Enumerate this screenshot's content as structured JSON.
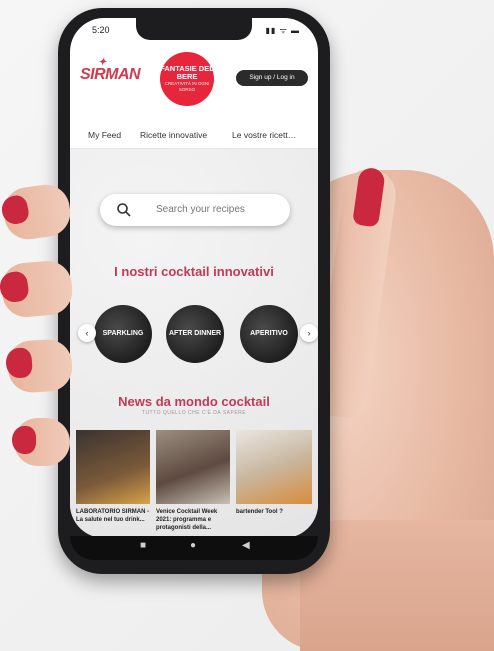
{
  "status": {
    "time": "5:20",
    "icons": "▮▮ ᯤ ▬"
  },
  "header": {
    "brand": "SIRMAN",
    "badge_line1": "FANTASIE DEL BERE",
    "badge_line2": "CREATIVITÀ IN OGNI SORSO",
    "signup": "Sign up / Log in"
  },
  "tabs": [
    {
      "label": "My Feed"
    },
    {
      "label": "Ricette innovative"
    },
    {
      "label": "Le vostre ricett…"
    }
  ],
  "search": {
    "placeholder": "Search your recipes"
  },
  "section_cocktails": {
    "title": "I nostri cocktail innovativi",
    "categories": [
      {
        "label": "SPARKLING"
      },
      {
        "label": "AFTER DINNER"
      },
      {
        "label": "APERITIVO"
      }
    ]
  },
  "section_news": {
    "title": "News da mondo cocktail",
    "subtitle": "TUTTO QUELLO CHE C'È DA SAPERE",
    "items": [
      {
        "caption": "LABORATORIO SIRMAN - La salute nel tuo drink..."
      },
      {
        "caption": "Venice Cocktail Week 2021: programma e protagonisti della..."
      },
      {
        "caption": "bartender Tool ?"
      }
    ]
  },
  "bottom_nav": {
    "square": "■",
    "home": "●",
    "back": "◀"
  },
  "colors": {
    "accent": "#c23a55",
    "badge": "#e8263b",
    "nail": "#c9283f"
  }
}
